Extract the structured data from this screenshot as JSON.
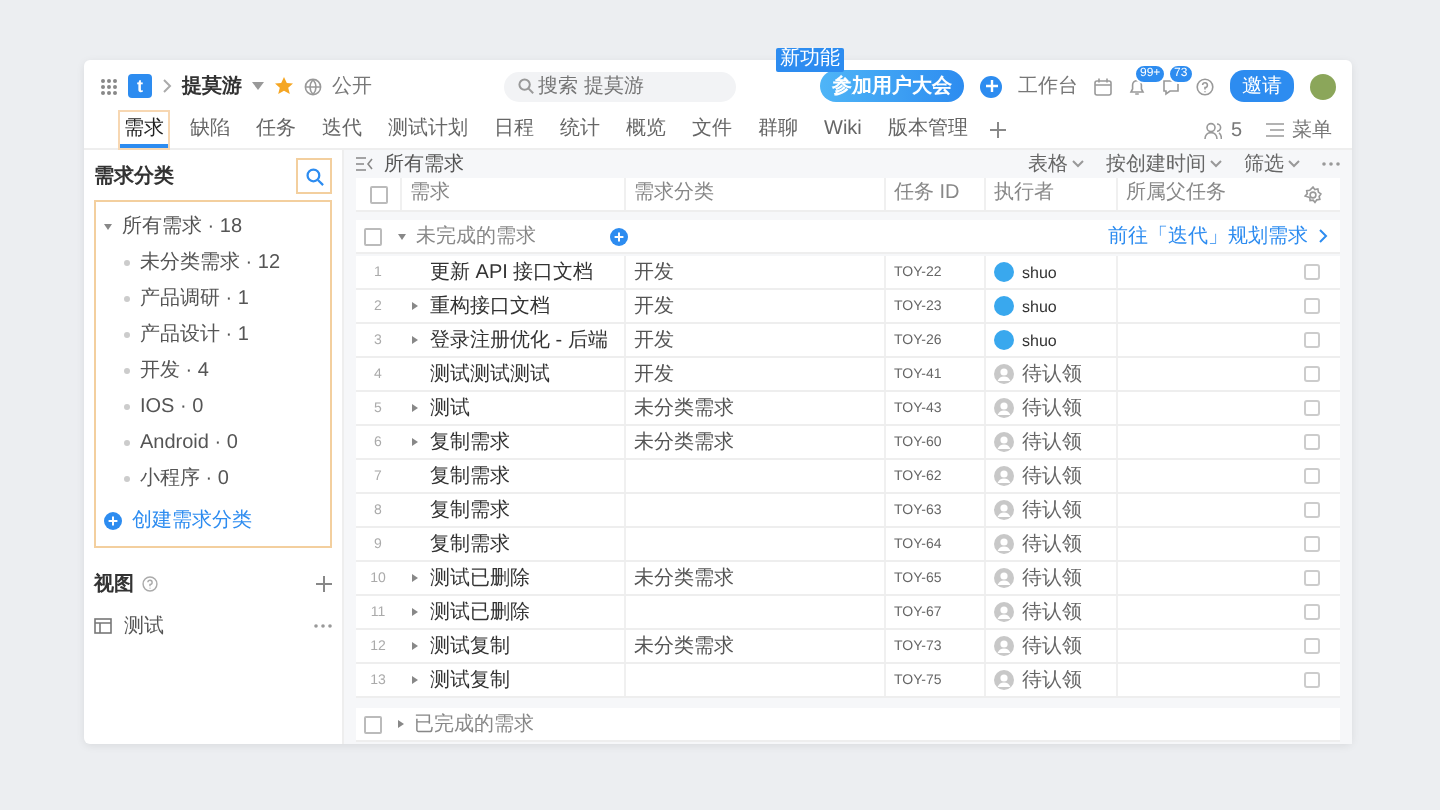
{
  "topbar": {
    "logo_letter": "t",
    "app_name": "提莫游",
    "visibility": "公开",
    "search": {
      "placeholder": "搜索 提莫游"
    },
    "new_badge": "新功能",
    "promo_button": "参加用户大会",
    "workbench": "工作台",
    "notifications_badge": "99+",
    "messages_badge": "73",
    "invite_button": "邀请"
  },
  "tabs": [
    {
      "label": "需求",
      "selected": true
    },
    {
      "label": "缺陷",
      "selected": false
    },
    {
      "label": "任务",
      "selected": false
    },
    {
      "label": "迭代",
      "selected": false
    },
    {
      "label": "测试计划",
      "selected": false
    },
    {
      "label": "日程",
      "selected": false
    },
    {
      "label": "统计",
      "selected": false
    },
    {
      "label": "概览",
      "selected": false
    },
    {
      "label": "文件",
      "selected": false
    },
    {
      "label": "群聊",
      "selected": false
    },
    {
      "label": "Wiki",
      "selected": false
    },
    {
      "label": "版本管理",
      "selected": false
    }
  ],
  "members_count": "5",
  "menu_label": "菜单",
  "sidebar": {
    "title": "需求分类",
    "tree": {
      "label": "所有需求 · 18",
      "expanded": true,
      "children": [
        {
          "label": "未分类需求 · 12"
        },
        {
          "label": "产品调研 · 1"
        },
        {
          "label": "产品设计 · 1"
        },
        {
          "label": "开发 · 4"
        },
        {
          "label": "IOS · 0"
        },
        {
          "label": "Android · 0"
        },
        {
          "label": "小程序 · 0"
        }
      ]
    },
    "create_link": "创建需求分类",
    "views_title": "视图",
    "views": [
      {
        "label": "测试"
      }
    ]
  },
  "toolbar": {
    "title": "所有需求",
    "options": [
      "表格",
      "按创建时间",
      "筛选"
    ]
  },
  "table": {
    "all_checked": false,
    "columns": [
      "需求",
      "需求分类",
      "任务 ID",
      "执行者",
      "所属父任务"
    ],
    "groups": [
      {
        "label": "未完成的需求",
        "checked": false,
        "expanded": true,
        "link": "前往「迭代」规划需求",
        "rows": [
          {
            "number": "1",
            "title": "更新 API 接口文档",
            "has_subtasks": false,
            "category": "开发",
            "task_id": "TOY-22",
            "assignee": {
              "kind": "user",
              "name": "shuo"
            }
          },
          {
            "number": "2",
            "title": "重构接口文档",
            "has_subtasks": true,
            "category": "开发",
            "task_id": "TOY-23",
            "assignee": {
              "kind": "user",
              "name": "shuo"
            }
          },
          {
            "number": "3",
            "title": "登录注册优化 - 后端",
            "has_subtasks": true,
            "category": "开发",
            "task_id": "TOY-26",
            "assignee": {
              "kind": "user",
              "name": "shuo"
            }
          },
          {
            "number": "4",
            "title": "测试测试测试",
            "has_subtasks": false,
            "category": "开发",
            "task_id": "TOY-41",
            "assignee": {
              "kind": "unclaimed",
              "name": "待认领"
            }
          },
          {
            "number": "5",
            "title": "测试",
            "has_subtasks": true,
            "category": "未分类需求",
            "task_id": "TOY-43",
            "assignee": {
              "kind": "unclaimed",
              "name": "待认领"
            }
          },
          {
            "number": "6",
            "title": "复制需求",
            "has_subtasks": true,
            "category": "未分类需求",
            "task_id": "TOY-60",
            "assignee": {
              "kind": "unclaimed",
              "name": "待认领"
            }
          },
          {
            "number": "7",
            "title": "复制需求",
            "has_subtasks": false,
            "task_id": "TOY-62",
            "assignee": {
              "kind": "unclaimed",
              "name": "待认领"
            }
          },
          {
            "number": "8",
            "title": "复制需求",
            "has_subtasks": false,
            "task_id": "TOY-63",
            "assignee": {
              "kind": "unclaimed",
              "name": "待认领"
            }
          },
          {
            "number": "9",
            "title": "复制需求",
            "has_subtasks": false,
            "task_id": "TOY-64",
            "assignee": {
              "kind": "unclaimed",
              "name": "待认领"
            }
          },
          {
            "number": "10",
            "title": "测试已删除",
            "has_subtasks": true,
            "category": "未分类需求",
            "task_id": "TOY-65",
            "assignee": {
              "kind": "unclaimed",
              "name": "待认领"
            }
          },
          {
            "number": "11",
            "title": "测试已删除",
            "has_subtasks": true,
            "task_id": "TOY-67",
            "assignee": {
              "kind": "unclaimed",
              "name": "待认领"
            }
          },
          {
            "number": "12",
            "title": "测试复制",
            "has_subtasks": true,
            "category": "未分类需求",
            "task_id": "TOY-73",
            "assignee": {
              "kind": "unclaimed",
              "name": "待认领"
            }
          },
          {
            "number": "13",
            "title": "测试复制",
            "has_subtasks": true,
            "task_id": "TOY-75",
            "assignee": {
              "kind": "unclaimed",
              "name": "待认领"
            }
          }
        ]
      },
      {
        "label": "已完成的需求",
        "checked": false,
        "expanded": false
      }
    ]
  }
}
